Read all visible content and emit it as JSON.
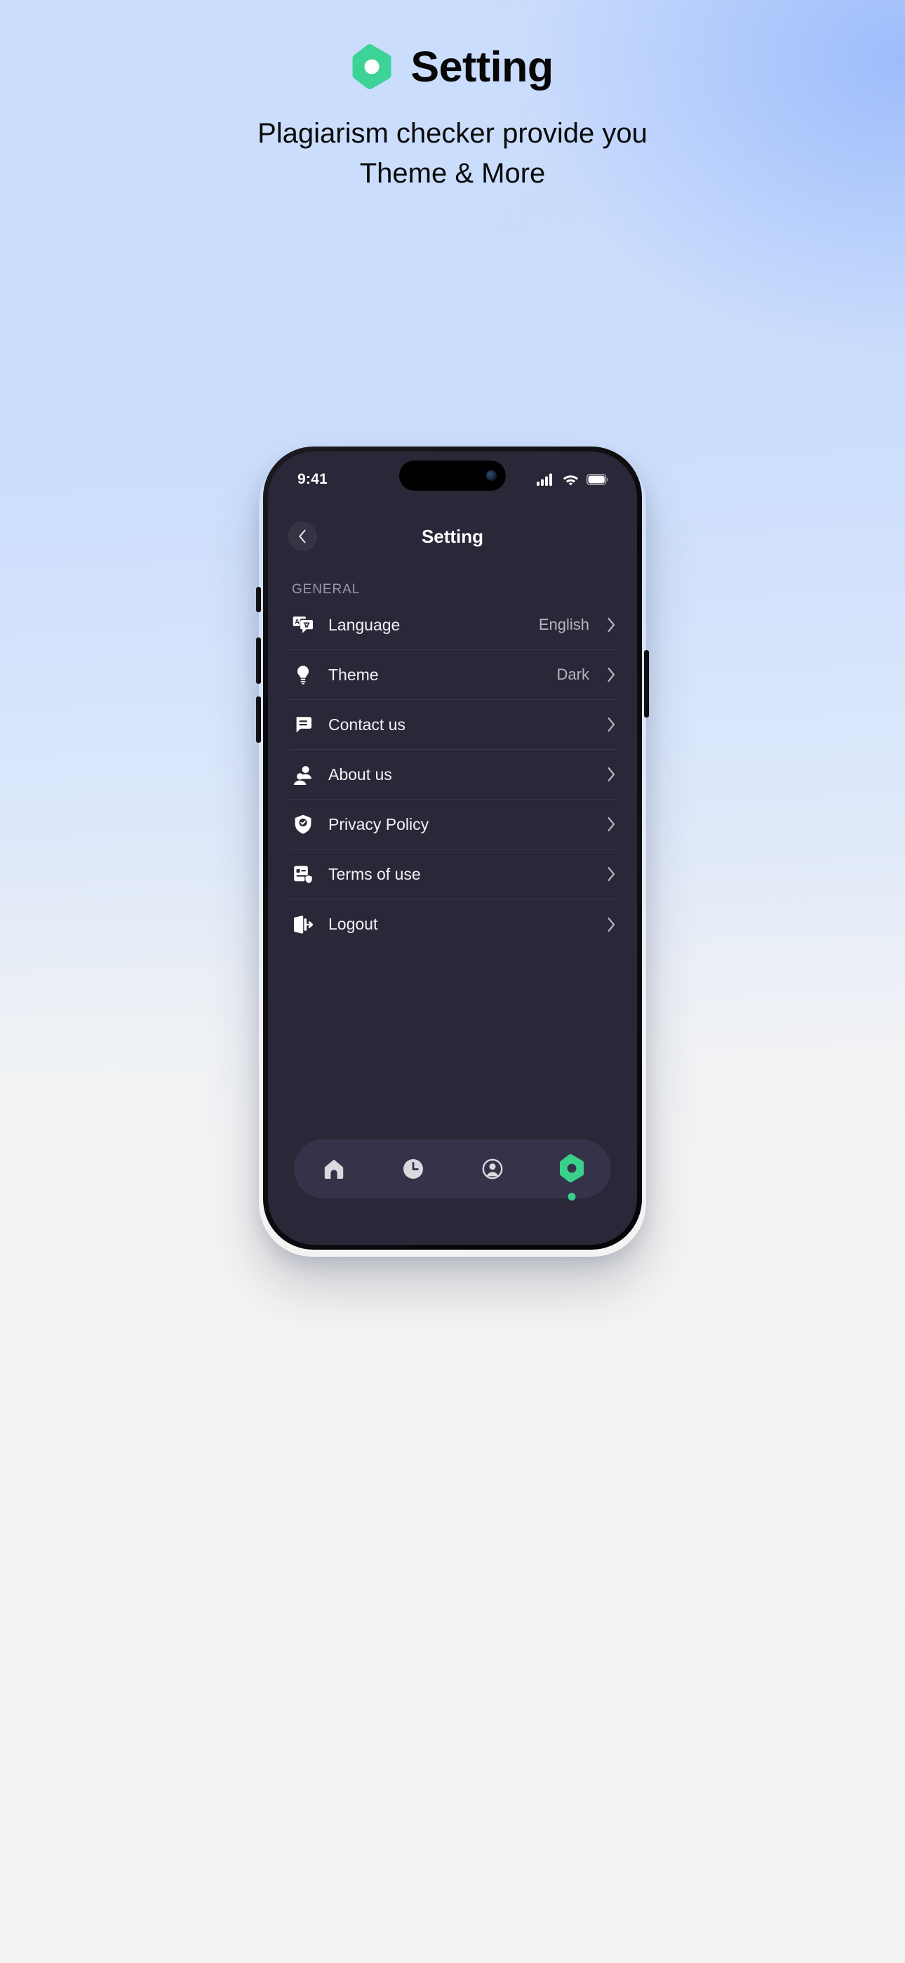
{
  "promo": {
    "title": "Setting",
    "logo_icon": "hexagon-dot-logo",
    "subtitle_line1": "Plagiarism checker provide you",
    "subtitle_line2": "Theme & More",
    "accent_color": "#3ed396",
    "background_top_color": "#cbdcfc",
    "background_bottom_color": "#f3f3f2"
  },
  "phone": {
    "statusbar": {
      "time": "9:41",
      "signal_icon": "cellular-signal-icon",
      "wifi_icon": "wifi-icon",
      "battery_icon": "battery-icon"
    },
    "header": {
      "back_icon": "chevron-left-icon",
      "title": "Setting"
    },
    "settings": {
      "section_label": "GENERAL",
      "rows": [
        {
          "icon": "translate-icon",
          "label": "Language",
          "value": "English",
          "chevron": "chevron-right-icon"
        },
        {
          "icon": "lightbulb-icon",
          "label": "Theme",
          "value": "Dark",
          "chevron": "chevron-right-icon"
        },
        {
          "icon": "chat-bubble-icon",
          "label": "Contact us",
          "value": "",
          "chevron": "chevron-right-icon"
        },
        {
          "icon": "people-icon",
          "label": "About us",
          "value": "",
          "chevron": "chevron-right-icon"
        },
        {
          "icon": "shield-check-icon",
          "label": "Privacy Policy",
          "value": "",
          "chevron": "chevron-right-icon"
        },
        {
          "icon": "document-shield-icon",
          "label": "Terms of use",
          "value": "",
          "chevron": "chevron-right-icon"
        },
        {
          "icon": "logout-icon",
          "label": "Logout",
          "value": "",
          "chevron": "chevron-right-icon"
        }
      ]
    },
    "tabbar": {
      "tabs": [
        {
          "icon": "home-icon",
          "active": false
        },
        {
          "icon": "clock-icon",
          "active": false
        },
        {
          "icon": "profile-icon",
          "active": false
        },
        {
          "icon": "hexagon-settings-icon",
          "active": true
        }
      ],
      "active_color": "#38d18c",
      "inactive_color": "#d9d9de",
      "bar_color": "#35334a"
    },
    "screen_background": "#2a2838",
    "divider_color": "#3a3849"
  }
}
